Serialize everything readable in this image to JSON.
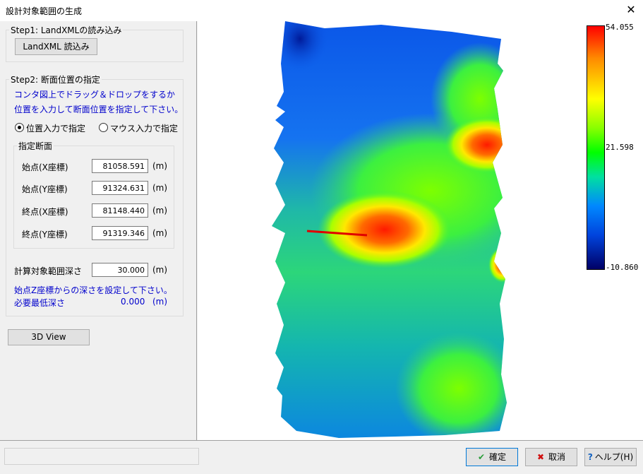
{
  "window": {
    "title": "設計対象範囲の生成",
    "close_glyph": "✕"
  },
  "step1": {
    "legend": "Step1: LandXMLの読み込み",
    "load_button": "LandXML 読込み"
  },
  "step2": {
    "legend": "Step2: 断面位置の指定",
    "hint_line1": "コンタ図上でドラッグ＆ドロップをするか",
    "hint_line2": "位置を入力して断面位置を指定して下さい。",
    "radio_position": "位置入力で指定",
    "radio_mouse": "マウス入力で指定",
    "section": {
      "legend": "指定断面",
      "rows": [
        {
          "label": "始点(X座標)",
          "value": "81058.591",
          "unit": "(m)"
        },
        {
          "label": "始点(Y座標)",
          "value": "91324.631",
          "unit": "(m)"
        },
        {
          "label": "終点(X座標)",
          "value": "81148.440",
          "unit": "(m)"
        },
        {
          "label": "終点(Y座標)",
          "value": "91319.346",
          "unit": "(m)"
        }
      ]
    },
    "depth_label": "計算対象範囲深さ",
    "depth_value": "30.000",
    "depth_unit": "(m)",
    "depth_hint": "始点Z座標からの深さを設定して下さい。",
    "min_depth_label": "必要最低深さ",
    "min_depth_value": "0.000",
    "min_depth_unit": "(m)"
  },
  "view3d_button": "3D View",
  "colorbar": {
    "max": "54.055",
    "mid": "21.598",
    "min": "-10.860"
  },
  "buttons": {
    "ok": "確定",
    "cancel": "取消",
    "help": "ヘルプ(H)"
  },
  "colors": {
    "link_blue": "#0000cc",
    "ok_green": "#2a9d3a",
    "cancel_red": "#d01010",
    "help_blue": "#1060c0"
  }
}
